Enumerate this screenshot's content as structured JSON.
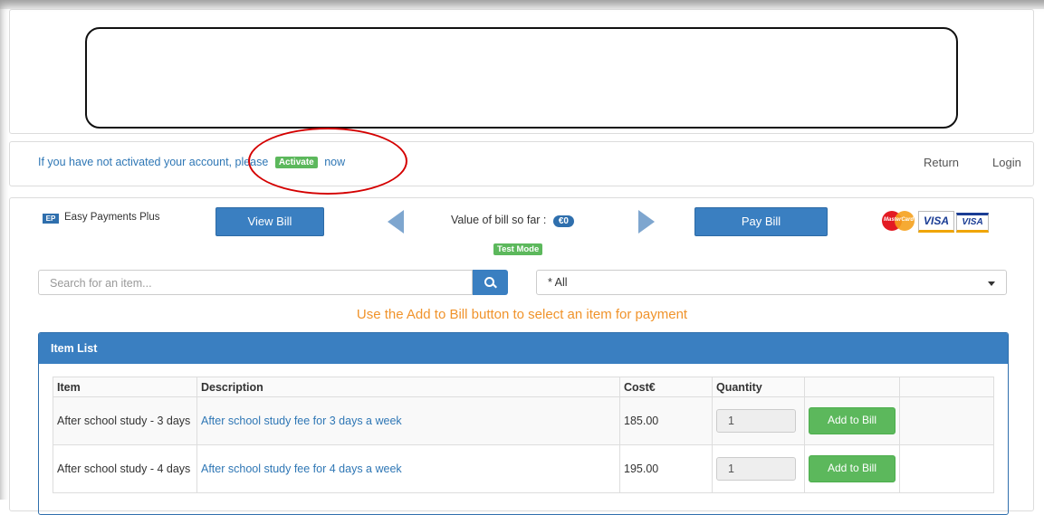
{
  "activation": {
    "prefix": "If you have not activated your account, please",
    "button": "Activate",
    "suffix": "now"
  },
  "nav": {
    "return": "Return",
    "login": "Login"
  },
  "brand": {
    "logo_text": "EP",
    "name": "Easy Payments Plus"
  },
  "toolbar": {
    "view_bill": "View Bill",
    "pay_bill": "Pay Bill",
    "bill_label": "Value of bill so far :",
    "bill_value": "€0",
    "test_mode": "Test Mode"
  },
  "cards": {
    "mastercard": "MasterCard",
    "visa": "VISA",
    "visa_electron": "VISA"
  },
  "search": {
    "placeholder": "Search for an item..."
  },
  "category": {
    "selected": "* All"
  },
  "instruction": "Use the Add to Bill button to select an item for payment",
  "item_list": {
    "title": "Item List",
    "columns": [
      "Item",
      "Description",
      "Cost€",
      "Quantity",
      "",
      ""
    ],
    "rows": [
      {
        "item": "After school study - 3 days",
        "description": "After school study fee for 3 days a week",
        "cost": "185.00",
        "qty": "1",
        "action": "Add to Bill"
      },
      {
        "item": "After school study - 4 days",
        "description": "After school study fee for 4 days a week",
        "cost": "195.00",
        "qty": "1",
        "action": "Add to Bill"
      }
    ]
  },
  "colors": {
    "primary": "#3a7fc1",
    "success": "#5cb85c",
    "accent": "#f0932b",
    "annotation": "#d40000"
  }
}
